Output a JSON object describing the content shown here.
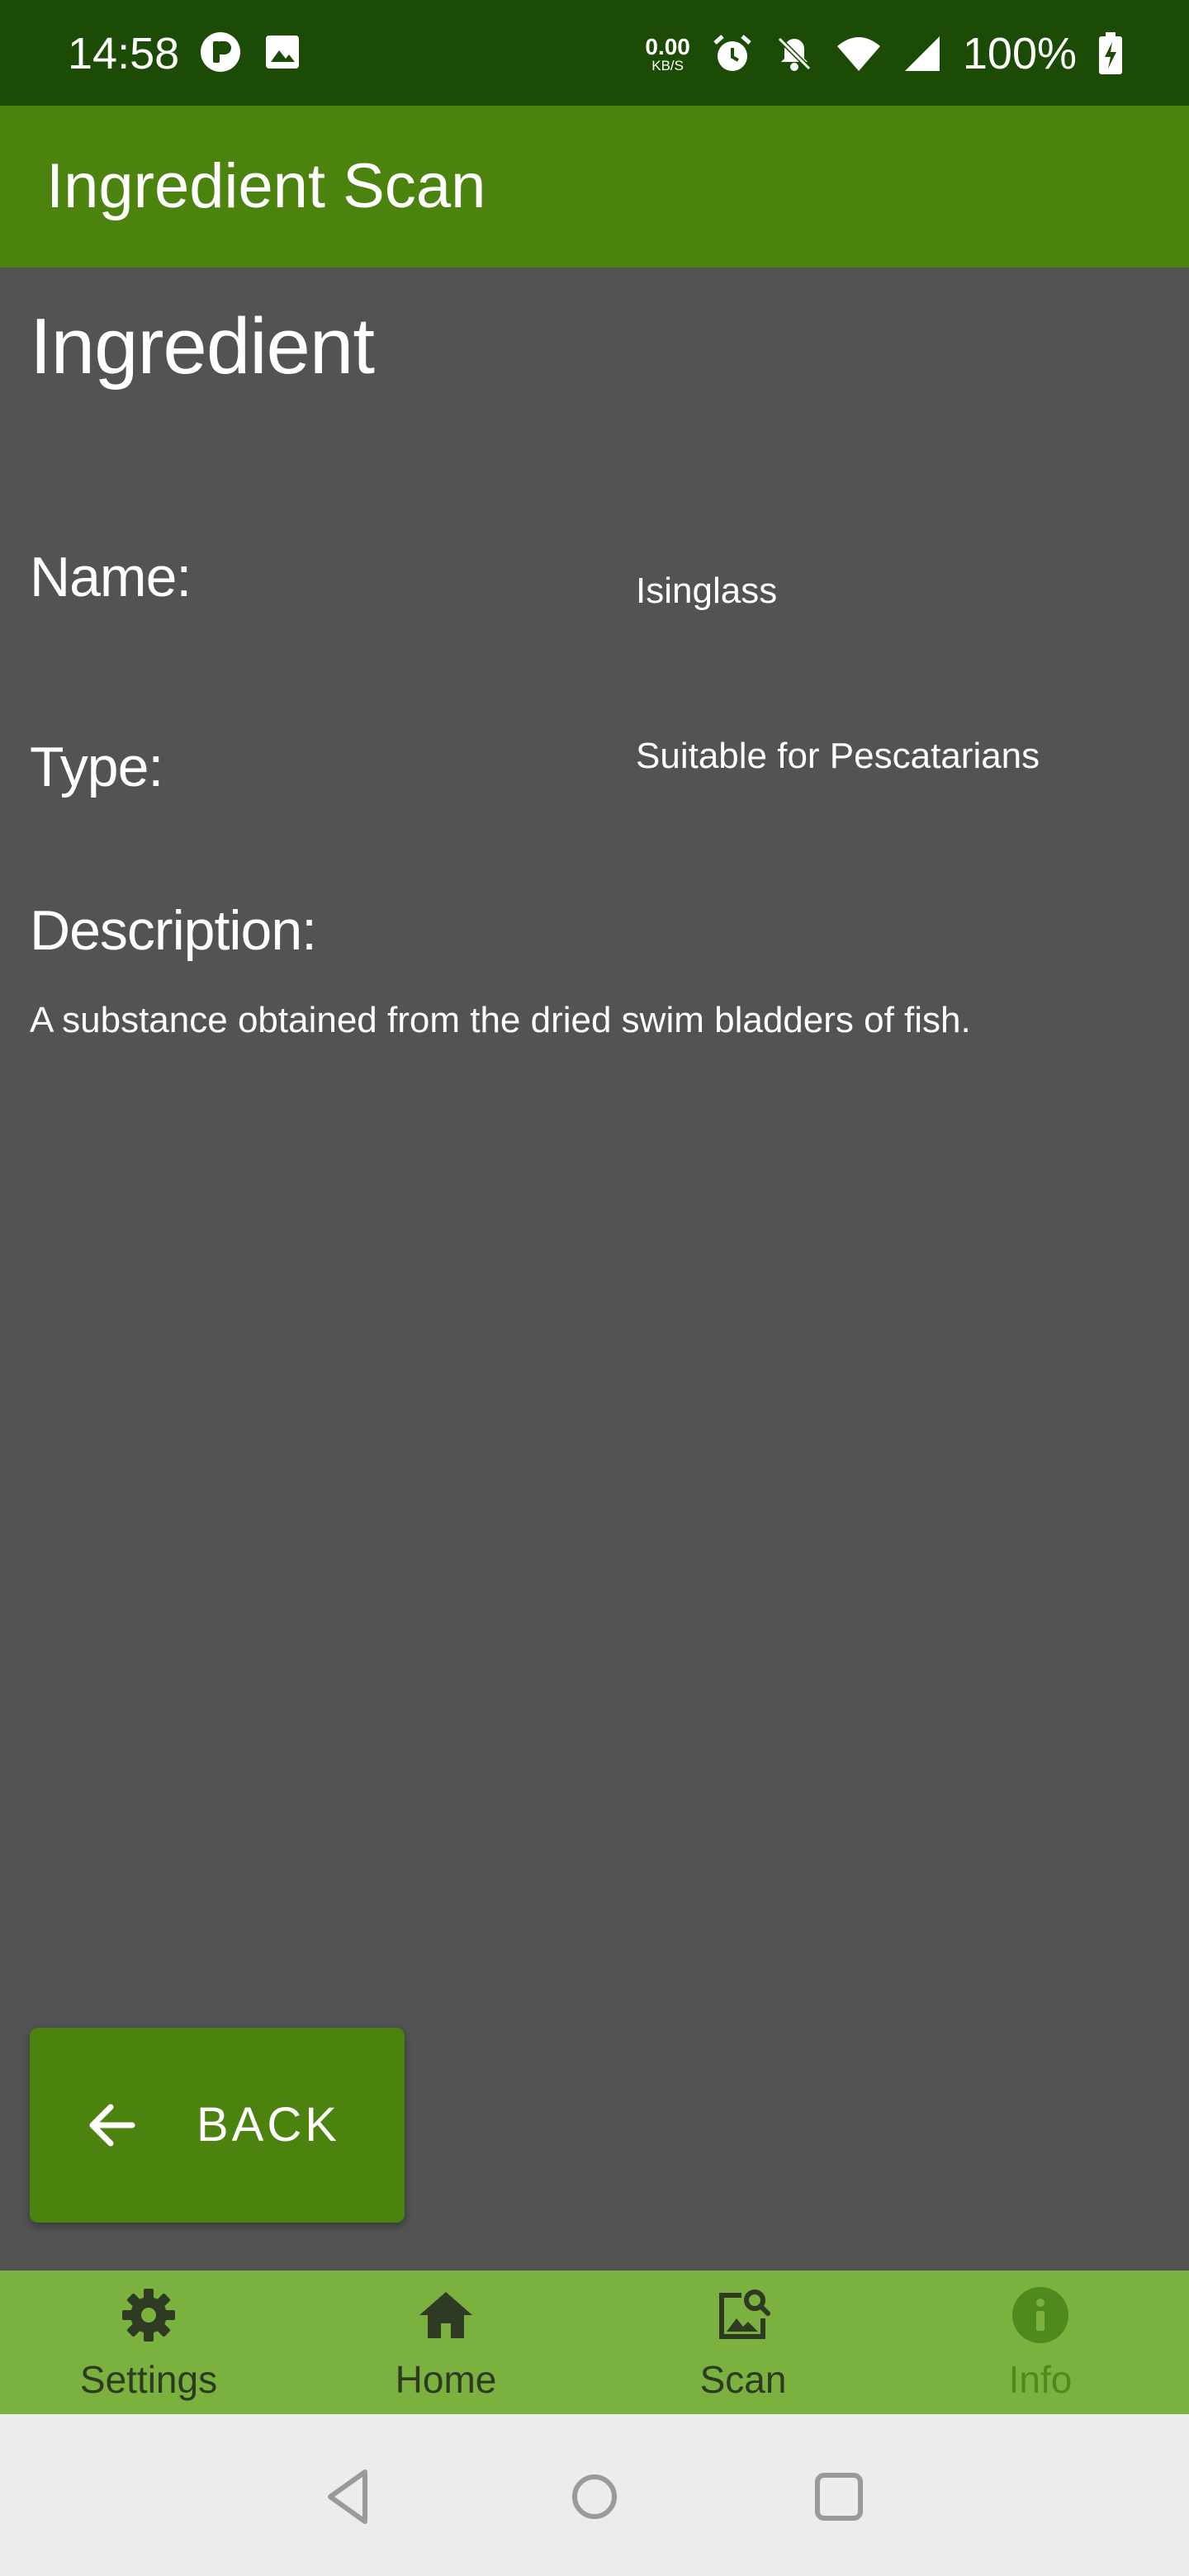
{
  "status_bar": {
    "time": "14:58",
    "net_speed": "0.00",
    "net_unit": "KB/S",
    "battery": "100%",
    "icons": [
      "notification-app-icon",
      "image-icon",
      "alarm-icon",
      "bell-off-icon",
      "wifi-icon",
      "signal-icon",
      "battery-charging-icon"
    ]
  },
  "app_bar": {
    "title": "Ingredient Scan"
  },
  "content": {
    "heading": "Ingredient",
    "name_label": "Name:",
    "name_value": "Isinglass",
    "type_label": "Type:",
    "type_value": "Suitable for Pescatarians",
    "description_label": "Description:",
    "description_text": "A substance obtained from the dried swim bladders of fish."
  },
  "back_button": {
    "label": "BACK",
    "icon": "arrow-left-icon"
  },
  "bottom_nav": {
    "items": [
      {
        "label": "Settings",
        "icon": "gear-icon"
      },
      {
        "label": "Home",
        "icon": "home-icon"
      },
      {
        "label": "Scan",
        "icon": "image-search-icon"
      },
      {
        "label": "Info",
        "icon": "info-icon"
      }
    ],
    "active": "Info"
  },
  "colors": {
    "status_bar": "#1c4b05",
    "app_bar": "#4b830e",
    "background": "#535353",
    "bottom_nav": "#7bb23f",
    "system_nav": "#ececec"
  }
}
